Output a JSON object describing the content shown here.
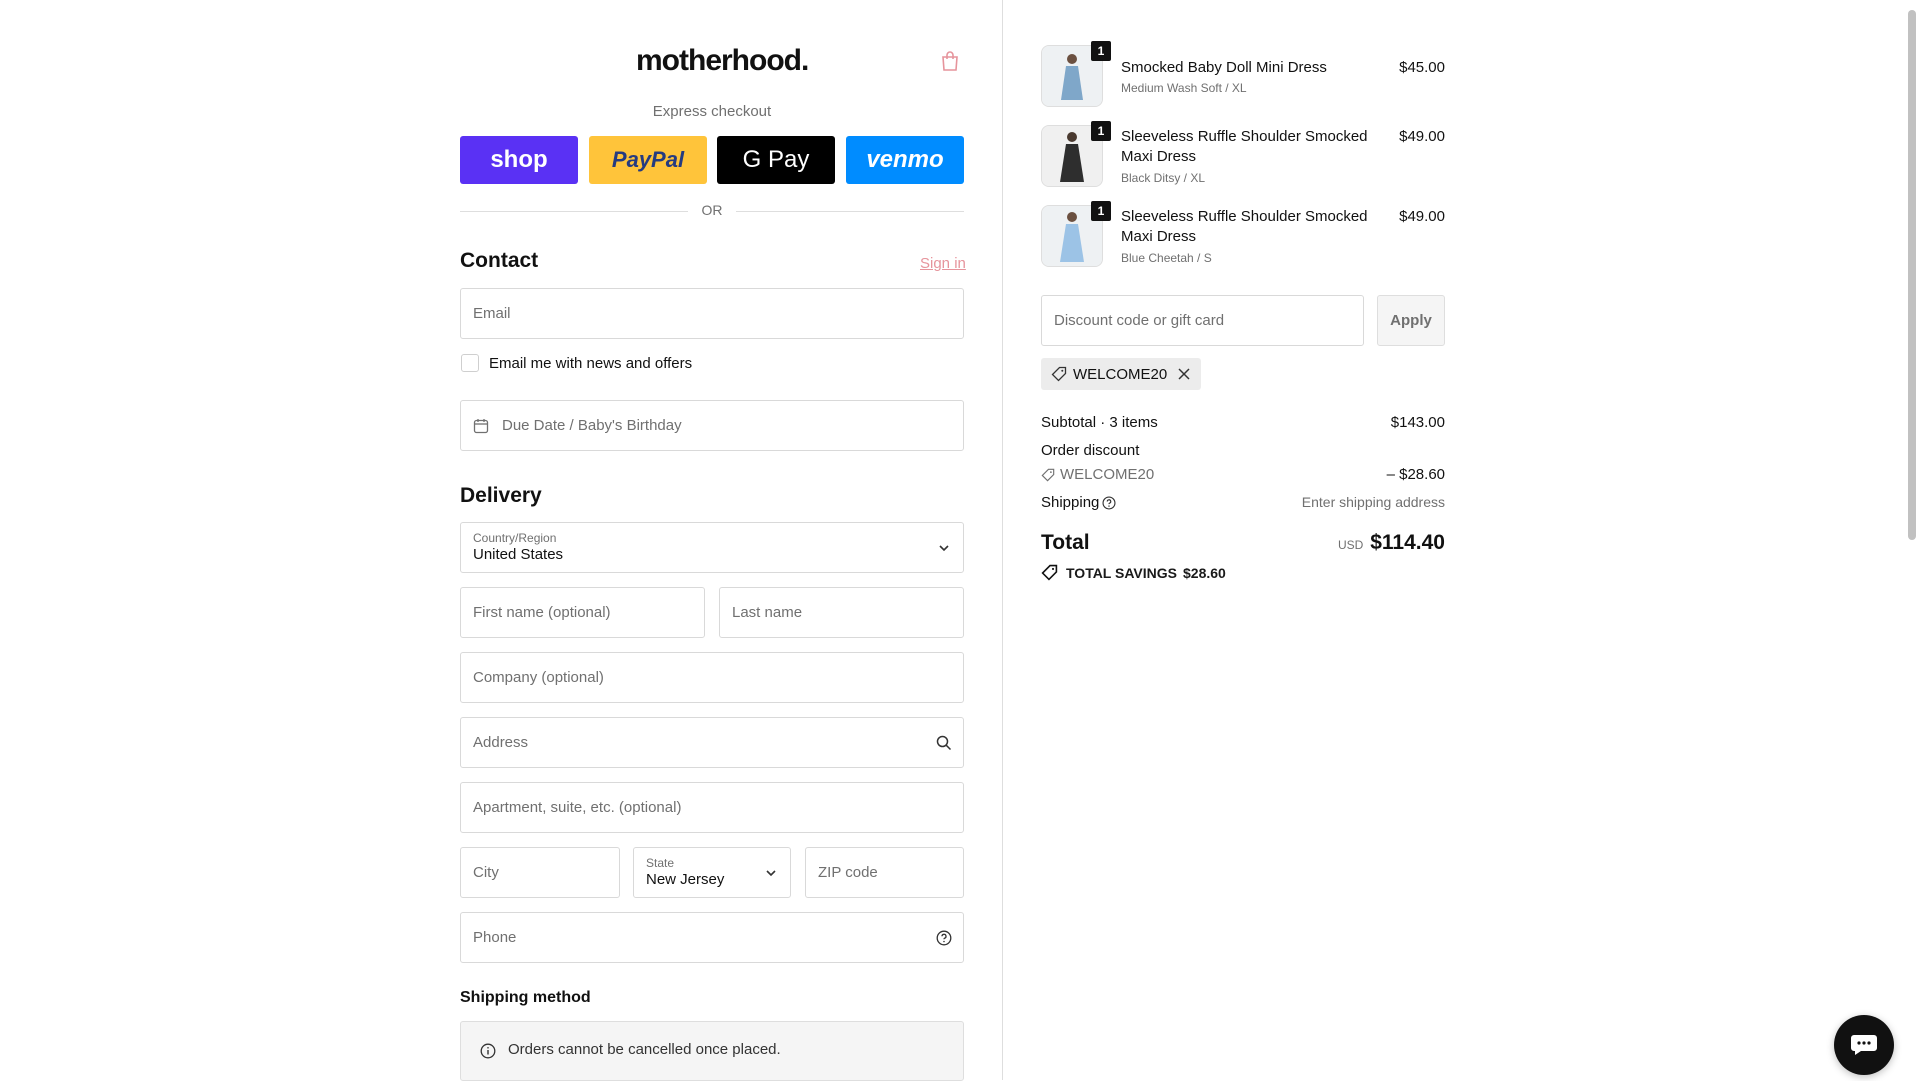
{
  "brand": {
    "logo_text": "motherhood."
  },
  "express": {
    "title": "Express checkout",
    "buttons": {
      "shop": "shop",
      "paypal": "PayPal",
      "gpay": "G Pay",
      "venmo": "venmo"
    },
    "or": "OR"
  },
  "contact": {
    "heading": "Contact",
    "sign_in": "Sign in",
    "email_placeholder": "Email",
    "news_label": "Email me with news and offers",
    "due_date_placeholder": "Due Date / Baby's Birthday"
  },
  "delivery": {
    "heading": "Delivery",
    "country_label": "Country/Region",
    "country_value": "United States",
    "first_name": "First name (optional)",
    "last_name": "Last name",
    "company": "Company (optional)",
    "address": "Address",
    "apartment": "Apartment, suite, etc. (optional)",
    "city": "City",
    "state_label": "State",
    "state_value": "New Jersey",
    "zip": "ZIP code",
    "phone": "Phone"
  },
  "shipping_method": {
    "heading": "Shipping method",
    "notice": "Orders cannot be cancelled once placed."
  },
  "cart": {
    "items": [
      {
        "name": "Smocked Baby Doll Mini Dress",
        "variant": "Medium Wash Soft / XL",
        "price": "$45.00",
        "qty": "1"
      },
      {
        "name": "Sleeveless Ruffle Shoulder Smocked Maxi Dress",
        "variant": "Black Ditsy / XL",
        "price": "$49.00",
        "qty": "1"
      },
      {
        "name": "Sleeveless Ruffle Shoulder Smocked Maxi Dress",
        "variant": "Blue Cheetah / S",
        "price": "$49.00",
        "qty": "1"
      }
    ],
    "discount_placeholder": "Discount code or gift card",
    "apply": "Apply",
    "applied_code": "WELCOME20",
    "subtotal_label": "Subtotal · 3 items",
    "subtotal_value": "$143.00",
    "order_discount_label": "Order discount",
    "discount_code": "WELCOME20",
    "discount_value": "– $28.60",
    "shipping_label": "Shipping",
    "shipping_value": "Enter shipping address",
    "total_label": "Total",
    "currency": "USD",
    "total_value": "$114.40",
    "savings_label": "TOTAL SAVINGS",
    "savings_value": "$28.60"
  },
  "colors": {
    "shop": "#5a31f4",
    "paypal": "#ffc43a",
    "gpay": "#000000",
    "venmo": "#008cff",
    "sign_in": "#e6949c"
  }
}
